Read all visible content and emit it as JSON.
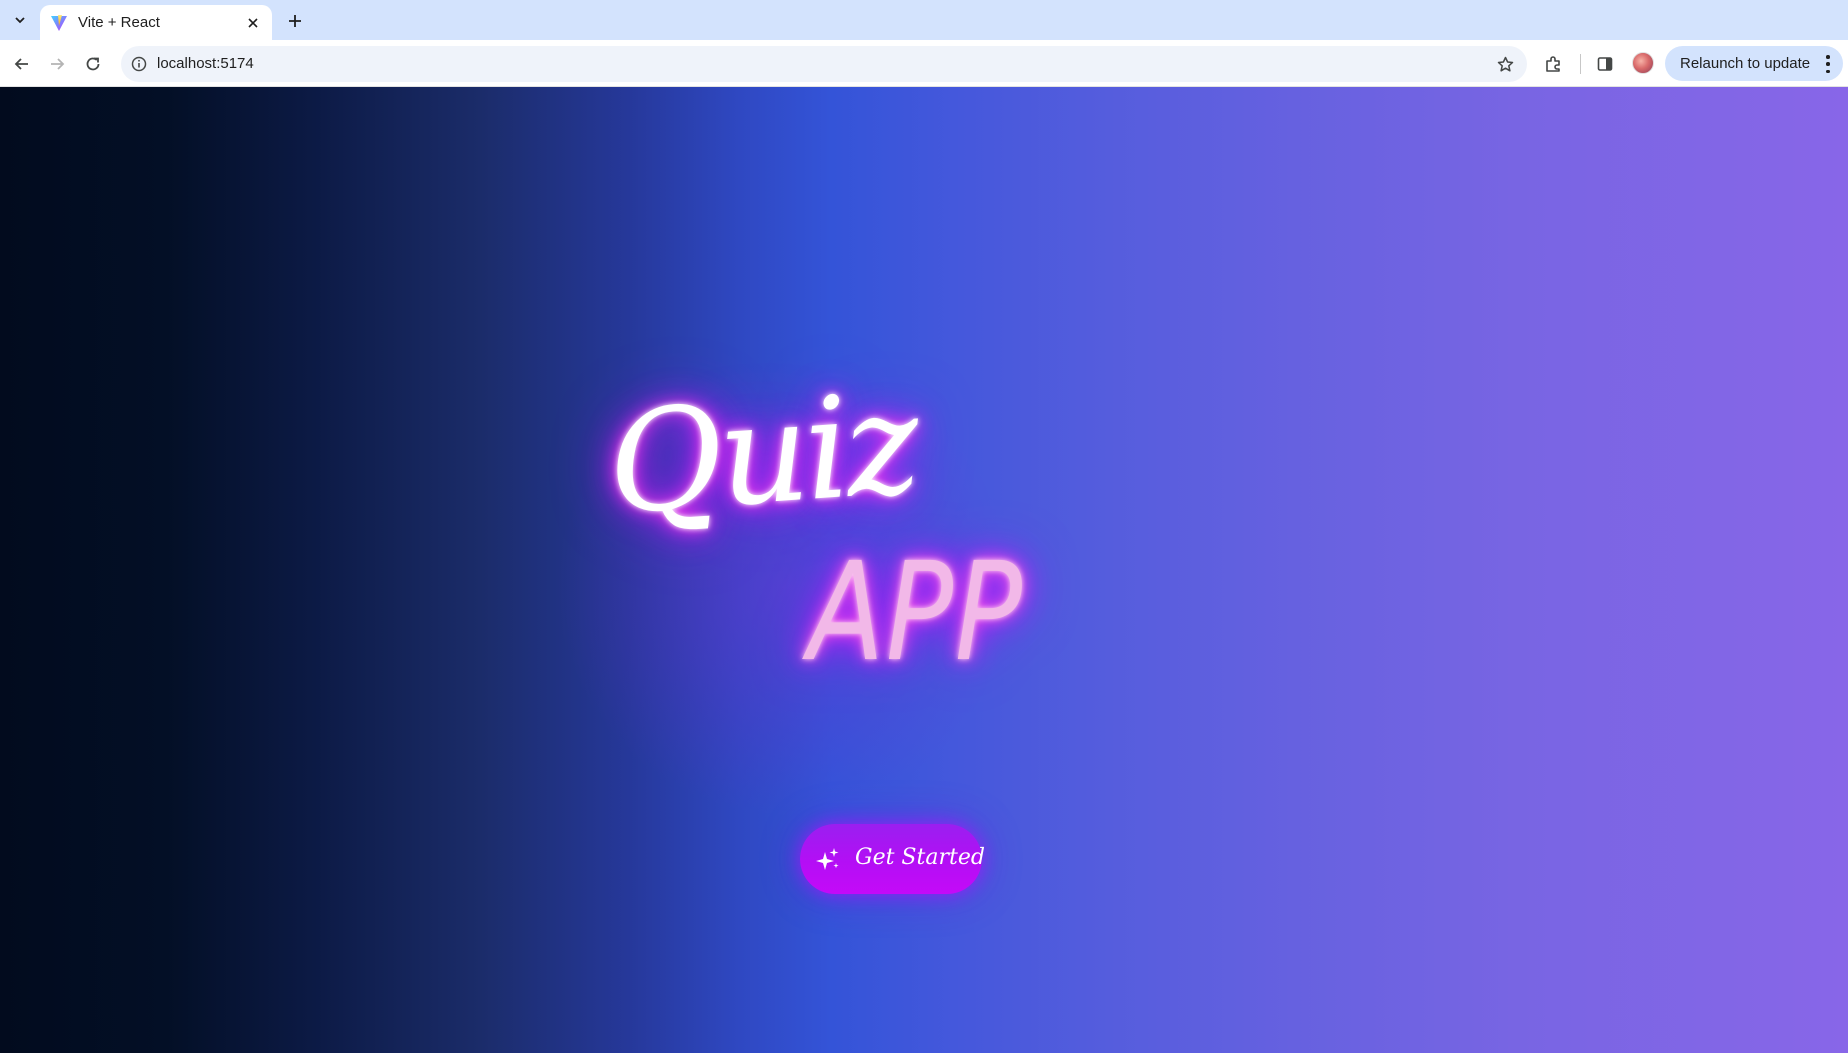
{
  "browser": {
    "tab": {
      "title": "Vite + React",
      "close_icon": "close-icon",
      "favicon": "vite-logo-icon"
    },
    "new_tab_icon": "plus-icon",
    "omnibox": {
      "url": "localhost:5174",
      "info_icon": "info-icon",
      "bookmark_icon": "star-icon"
    },
    "relaunch": {
      "label": "Relaunch to update"
    }
  },
  "page": {
    "title_line1": "Quiz",
    "title_line2": "APP",
    "cta": {
      "label": "Get Started",
      "icon": "sparkles-icon"
    },
    "colors": {
      "bg_left": "#020b1e",
      "bg_mid": "#3454d8",
      "bg_right": "#8866e8",
      "title_glow": "#e020ff",
      "button": "#b40ef5"
    }
  }
}
